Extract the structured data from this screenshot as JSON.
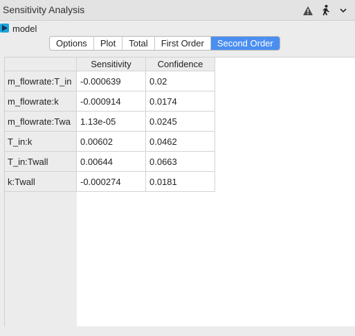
{
  "window": {
    "title": "Sensitivity Analysis"
  },
  "toolbar_icons": [
    "warning-icon",
    "run-icon",
    "chevron-down-icon"
  ],
  "model": {
    "label": "model",
    "icon_color": "#1aa3d9"
  },
  "tabs": [
    {
      "label": "Options",
      "active": false
    },
    {
      "label": "Plot",
      "active": false
    },
    {
      "label": "Total",
      "active": false
    },
    {
      "label": "First Order",
      "active": false
    },
    {
      "label": "Second Order",
      "active": true
    }
  ],
  "accent_color": "#4a8ff0",
  "table": {
    "columns": [
      "Sensitivity",
      "Confidence"
    ],
    "rows": [
      {
        "label": "m_flowrate:T_in",
        "values": [
          "-0.000639",
          "0.02"
        ]
      },
      {
        "label": "m_flowrate:k",
        "values": [
          "-0.000914",
          "0.0174"
        ]
      },
      {
        "label": "m_flowrate:Twa",
        "values": [
          "1.13e-05",
          "0.0245"
        ]
      },
      {
        "label": "T_in:k",
        "values": [
          "0.00602",
          "0.0462"
        ]
      },
      {
        "label": "T_in:Twall",
        "values": [
          "0.00644",
          "0.0663"
        ]
      },
      {
        "label": "k:Twall",
        "values": [
          "-0.000274",
          "0.0181"
        ]
      }
    ]
  }
}
